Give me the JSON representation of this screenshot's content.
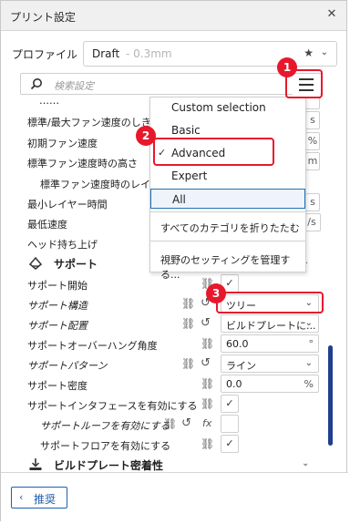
{
  "window": {
    "title": "プリント設定",
    "close_glyph": "✕"
  },
  "profile": {
    "label": "プロファイル",
    "name": "Draft",
    "sub": "- 0.3mm"
  },
  "search": {
    "placeholder": "検索設定"
  },
  "settings_rows": [
    {
      "label": "標準/最大ファン速度のしきい",
      "unit": "s"
    },
    {
      "label": "初期ファン速度",
      "unit": "%"
    },
    {
      "label": "標準ファン速度時の高さ",
      "unit": "m"
    },
    {
      "label": "標準ファン速度時のレイヤー"
    },
    {
      "label": "最小レイヤー時間",
      "unit": "s"
    },
    {
      "label": "最低速度",
      "unit": "/s"
    },
    {
      "label": "ヘッド持ち上げ"
    }
  ],
  "support_section": {
    "label": "サポート"
  },
  "support_rows": [
    {
      "label": "サポート開始",
      "checked": "✓"
    },
    {
      "label": "サポート構造",
      "value": "ツリー"
    },
    {
      "label": "サポート配置",
      "value": "ビルドプレートに..."
    },
    {
      "label": "サポートオーバーハング角度",
      "value": "60.0",
      "unit": "°"
    },
    {
      "label": "サポートパターン",
      "value": "ライン"
    },
    {
      "label": "サポート密度",
      "value": "0.0",
      "unit": "%"
    },
    {
      "label": "サポートインタフェースを有効にする",
      "checked": "✓"
    },
    {
      "label": "サポートルーフを有効にする"
    },
    {
      "label": "サポートフロアを有効にする",
      "checked": "✓"
    }
  ],
  "adhesion_section": {
    "label": "ビルドプレート密着性"
  },
  "dropdown": {
    "items": [
      {
        "label": "Custom selection"
      },
      {
        "label": "Basic"
      },
      {
        "label": "Advanced",
        "check": "✓"
      },
      {
        "label": "Expert"
      },
      {
        "label": "All"
      },
      {
        "label": "すべてのカテゴリを折りたたむ"
      },
      {
        "label": "視野のセッティングを管理する..."
      }
    ]
  },
  "badges": [
    "1",
    "2",
    "3"
  ],
  "footer": {
    "recommended_label": "推奨"
  },
  "colors": {
    "accent": "#1f5fb0",
    "highlight": "#e8182c",
    "scrollbar": "#1f3f8f"
  }
}
